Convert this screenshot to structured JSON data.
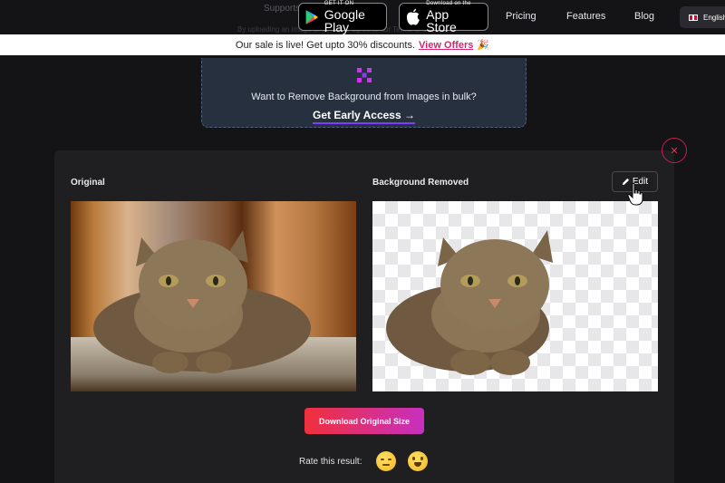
{
  "header": {
    "faint_text": "Supports",
    "faint_text_2": "By uploading an image or URL you agree to our Terms of Service",
    "google_play": {
      "small": "GET IT ON",
      "big": "Google Play"
    },
    "app_store": {
      "small": "Download on the",
      "big": "App Store"
    },
    "nav": [
      "Pricing",
      "Features",
      "Blog"
    ],
    "language": "English"
  },
  "banner": {
    "text": "Our sale is live! Get upto 30% discounts.",
    "link": "View Offers",
    "emoji": "🎉"
  },
  "bulk": {
    "text": "Want to Remove Background from Images in bulk?",
    "link": "Get Early Access →"
  },
  "result": {
    "close": "✕",
    "original_label": "Original",
    "removed_label": "Background Removed",
    "edit_label": "Edit",
    "download_label": "Download Original Size",
    "rate_label": "Rate this result:"
  },
  "colors": {
    "accent": "#d6246e",
    "download_gradient_start": "#f0303c",
    "download_gradient_end": "#c72fbf",
    "bulk_bg": "#26303f"
  }
}
